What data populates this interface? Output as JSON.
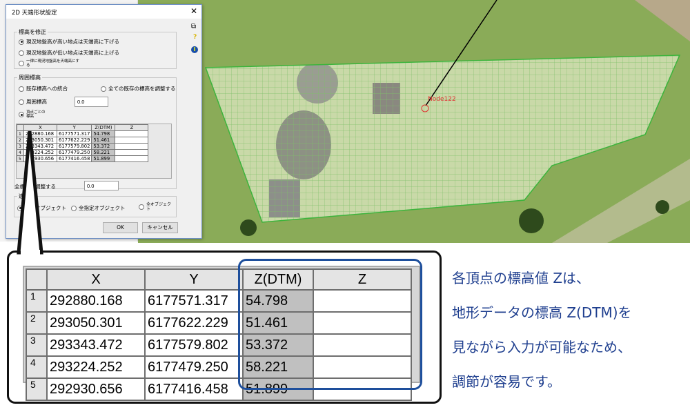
{
  "dialog": {
    "title": "2D 天端形状設定",
    "close_label": "✕",
    "group_modify": {
      "label": "標高を修正",
      "options": [
        "現況地盤高が高い地点は天端高に下げる",
        "現況地盤高が低い地点は天端高に上げる",
        "一律に現況地盤高を天端高にする"
      ],
      "selected": 0
    },
    "group_perimeter": {
      "label": "周囲標高",
      "opt_merge": "既存標高への統合",
      "opt_adjust_all": "全ての既存の標高を調整する",
      "opt_perimeter": "周囲標高",
      "perimeter_value": "0.0",
      "opt_vertex": "頂点ごとの標高",
      "selected": "vertex"
    },
    "adjust_all_label": "全標高を調整する",
    "adjust_all_value": "0.0",
    "group_apply": {
      "label": "適用",
      "options": [
        "選択オブジェクト",
        "全指定オブジェクト",
        "全オブジェクト"
      ],
      "selected": 0
    },
    "ok_label": "OK",
    "cancel_label": "キャンセル"
  },
  "table": {
    "columns": [
      "X",
      "Y",
      "Z(DTM)",
      "Z"
    ],
    "rows": [
      {
        "n": "1",
        "x": "292880.168",
        "y": "6177571.317",
        "zdtm": "54.798",
        "z": ""
      },
      {
        "n": "2",
        "x": "293050.301",
        "y": "6177622.229",
        "zdtm": "51.461",
        "z": ""
      },
      {
        "n": "3",
        "x": "293343.472",
        "y": "6177579.802",
        "zdtm": "53.372",
        "z": ""
      },
      {
        "n": "4",
        "x": "293224.252",
        "y": "6177479.250",
        "zdtm": "58.221",
        "z": ""
      },
      {
        "n": "5",
        "x": "292930.656",
        "y": "6177416.458",
        "zdtm": "51.899",
        "z": ""
      }
    ]
  },
  "map": {
    "node_label": "Node122"
  },
  "note": {
    "lines": [
      "各頂点の標高値 Zは、",
      "地形データの標高 Z(DTM)を",
      "見ながら入力が可能なため、",
      "調節が容易です。"
    ]
  },
  "colors": {
    "accent": "#1e4f9c",
    "boundary": "#3cb43c",
    "node": "#e03030"
  }
}
